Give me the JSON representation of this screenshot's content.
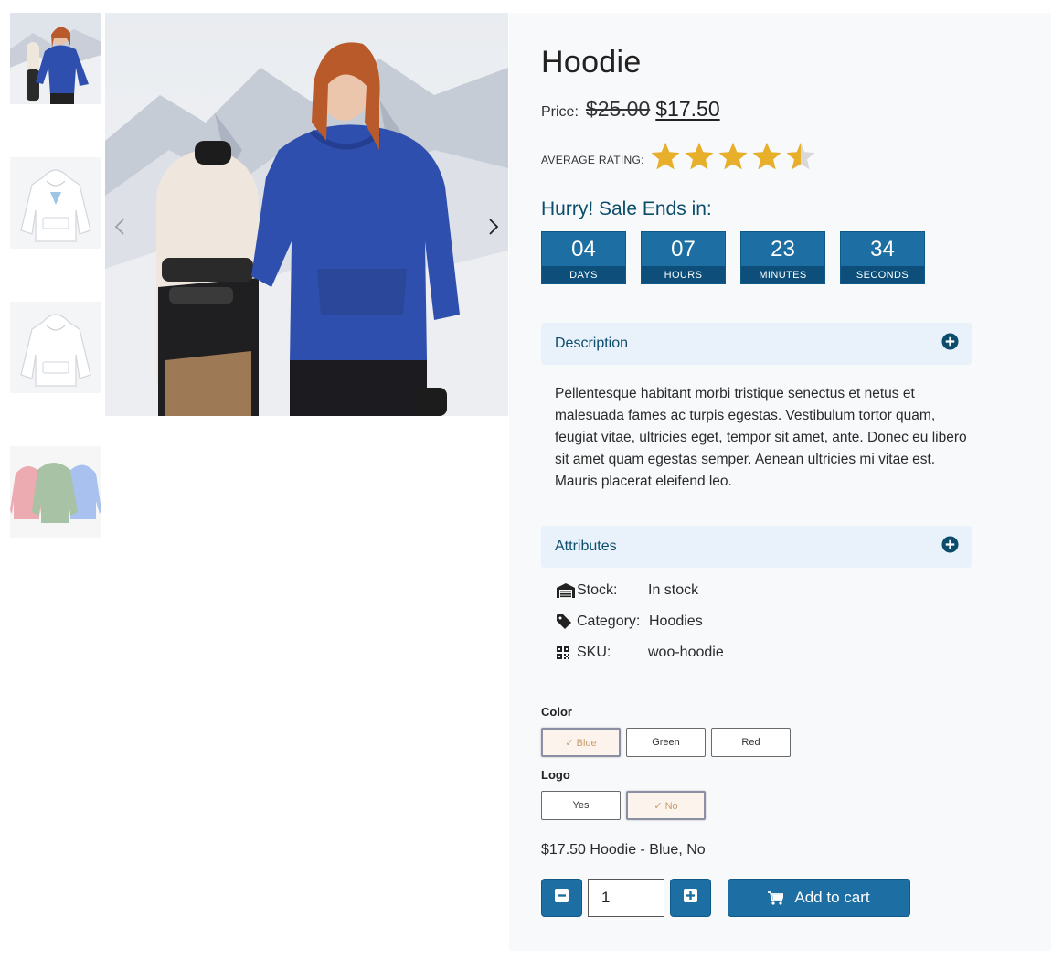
{
  "product": {
    "title": "Hoodie",
    "price_label": "Price:",
    "price_regular": "$25.00",
    "price_sale": "$17.50",
    "rating_label": "AVERAGE RATING:",
    "rating_value": 4.5,
    "rating_max": 5
  },
  "gallery": {
    "thumbnails": [
      {
        "icon": "model-hoodie-blue-thumb"
      },
      {
        "icon": "white-hoodie-front-thumb"
      },
      {
        "icon": "white-hoodie-plain-thumb"
      },
      {
        "icon": "hoodies-pink-green-blue-thumb"
      }
    ],
    "accent_blue": "#2f4fae"
  },
  "countdown": {
    "heading": "Hurry! Sale Ends in:",
    "units": [
      {
        "value": "04",
        "label": "DAYS"
      },
      {
        "value": "07",
        "label": "HOURS"
      },
      {
        "value": "23",
        "label": "MINUTES"
      },
      {
        "value": "34",
        "label": "SECONDS"
      }
    ],
    "color": "#1d6fa3"
  },
  "description": {
    "heading": "Description",
    "text": "Pellentesque habitant morbi tristique senectus et netus et malesuada fames ac turpis egestas. Vestibulum tortor quam, feugiat vitae, ultricies eget, tempor sit amet, ante. Donec eu libero sit amet quam egestas semper. Aenean ultricies mi vitae est. Mauris placerat eleifend leo."
  },
  "attributes": {
    "heading": "Attributes",
    "rows": [
      {
        "icon": "warehouse-icon",
        "key": "Stock:",
        "value": "In stock"
      },
      {
        "icon": "tag-icon",
        "key": "Category:",
        "value": "Hoodies"
      },
      {
        "icon": "qrcode-icon",
        "key": "SKU:",
        "value": "woo-hoodie"
      }
    ]
  },
  "variations": {
    "color_label": "Color",
    "color_options": [
      {
        "label": "✓ Blue",
        "selected": true
      },
      {
        "label": "Green",
        "selected": false
      },
      {
        "label": "Red",
        "selected": false
      }
    ],
    "logo_label": "Logo",
    "logo_options": [
      {
        "label": "Yes",
        "selected": false
      },
      {
        "label": "✓ No",
        "selected": true
      }
    ],
    "summary": "$17.50 Hoodie - Blue, No"
  },
  "cart": {
    "quantity": "1",
    "add_label": "Add to cart"
  }
}
